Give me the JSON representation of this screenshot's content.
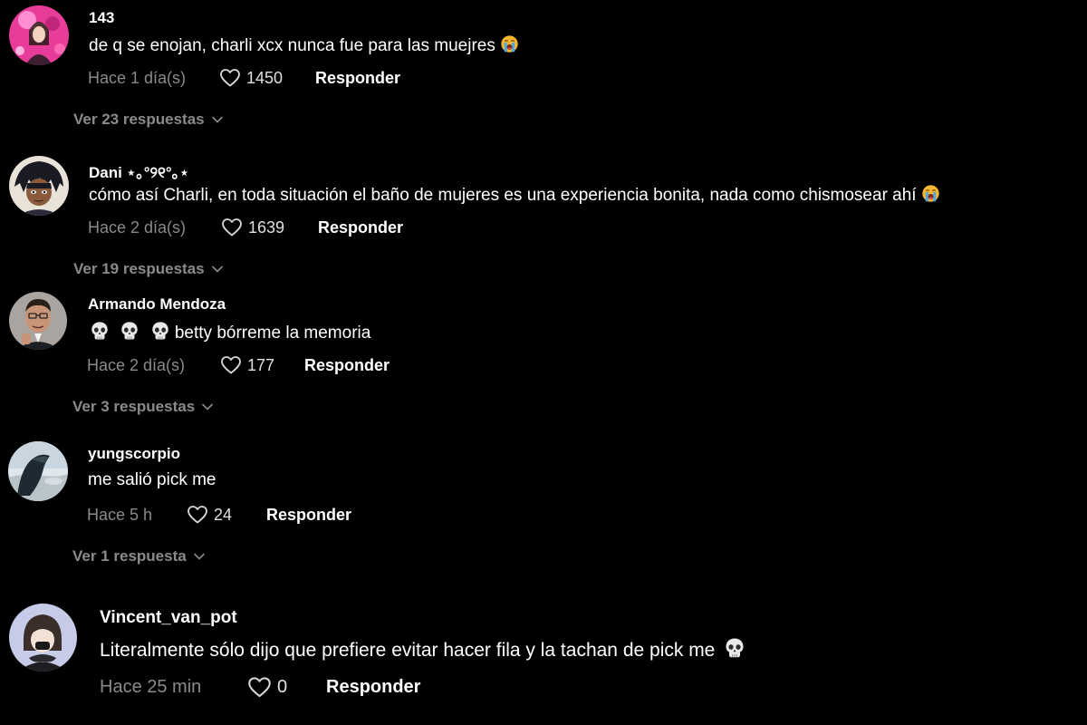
{
  "comments": [
    {
      "username": "143",
      "text": "de q se enojan, charli xcx nunca fue para las muejres",
      "emoji": "loudly-crying-face",
      "time": "Hace 1 día(s)",
      "likes": "1450",
      "reply_label": "Responder",
      "view_replies": "Ver 23 respuestas"
    },
    {
      "username": "Dani ⋆｡°୨୧°｡⋆",
      "text": "cómo así Charli, en toda situación el baño de mujeres es una experiencia bonita, nada como chismosear ahí",
      "emoji": "loudly-crying-face",
      "time": "Hace 2 día(s)",
      "likes": "1639",
      "reply_label": "Responder",
      "view_replies": "Ver 19 respuestas"
    },
    {
      "username": "Armando Mendoza",
      "text": "betty bórreme la memoria",
      "emoji_prefix": "skull x3",
      "time": "Hace 2 día(s)",
      "likes": "177",
      "reply_label": "Responder",
      "view_replies": "Ver 3 respuestas"
    },
    {
      "username": "yungscorpio",
      "text": "me salió pick me",
      "time": "Hace 5 h",
      "likes": "24",
      "reply_label": "Responder",
      "view_replies": "Ver 1 respuesta"
    },
    {
      "username": "Vincent_van_pot",
      "text": "Literalmente sólo dijo que prefiere evitar hacer fila y la tachan de pick me",
      "emoji": "skull",
      "time": "Hace 25 min",
      "likes": "0",
      "reply_label": "Responder"
    }
  ],
  "colors": {
    "background": "#000000",
    "text": "#ffffff",
    "muted": "#8a8a8a"
  }
}
